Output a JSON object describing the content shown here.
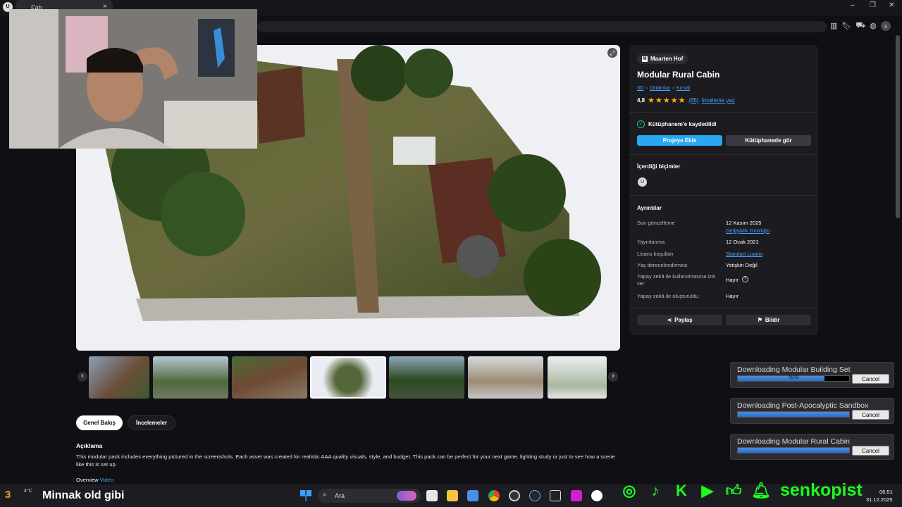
{
  "browser": {
    "tab_title": "Fab",
    "close_glyph": "×",
    "avatar_letter": "s"
  },
  "window": {
    "minimize": "–",
    "restore": "❐",
    "close": "✕"
  },
  "product": {
    "seller": "Maarten Hof",
    "title": "Modular Rural Cabin",
    "breadcrumb": [
      "3D",
      "Ortamlar",
      "Kırsal"
    ],
    "rating": "4,8",
    "stars": 5,
    "review_count": "(85)",
    "write_review": "İnceleme yaz",
    "saved_label": "Kütüphanem'e kaydedildi",
    "add_to_project": "Projeye Ekle",
    "view_in_library": "Kütüphanede gör",
    "formats_title": "İçerdiği biçimler",
    "details_title": "Ayrıntılar",
    "details": [
      {
        "label": "Son güncelleme",
        "value": "12 Kasım 2025",
        "link": "Değişiklik Günlüğü"
      },
      {
        "label": "Yayınlanma",
        "value": "12 Ocak 2021"
      },
      {
        "label": "Lisans koşulları",
        "value": "Standart Lisans",
        "is_link": true
      },
      {
        "label": "Yaş derecelendirmesi",
        "value": "Yetişkin Değil"
      },
      {
        "label": "Yapay zekâ ile kullanılmasına izin ver",
        "value": "Hayır",
        "help": true
      },
      {
        "label": "Yapay zekâ ile oluşturuldu",
        "value": "Hayır"
      }
    ],
    "share": "Paylaş",
    "report": "Bildir"
  },
  "thumbnails": {
    "count": 7,
    "selected_index": 3,
    "prev": "‹",
    "next": "›"
  },
  "tabs": [
    "Genel Bakış",
    "İncelemeler"
  ],
  "description": {
    "heading": "Açıklama",
    "text": "This modular pack includes everything pictured in the screenshots. Each asset was created for realistic AAA quality visuals, style, and budget. This pack can be perfect for your next game, lighting study or just to see how a scene like this is set up.",
    "overview_label": "Overview",
    "overview_link": "Video"
  },
  "downloads": [
    {
      "title": "Downloading Modular Building Set",
      "progress": 0.78,
      "progress_text": "%78",
      "cancel": "Cancel"
    },
    {
      "title": "Downloading Post-Apocalyptic Sandbox",
      "progress": 1.0,
      "progress_text": "",
      "cancel": "Cancel"
    },
    {
      "title": "Downloading Modular Rural Cabin",
      "progress": 1.0,
      "progress_text": "",
      "cancel": "Cancel"
    }
  ],
  "taskbar": {
    "weather_temp": "4°C",
    "overlay_number": "3",
    "now_playing": "Minnak old gibi",
    "search_placeholder": "Ara",
    "time": "06:51",
    "date": "31.12.2025"
  },
  "stream_overlay": {
    "handle": "senkopist"
  },
  "colors": {
    "accent": "#29a8f2",
    "link": "#4aa3ff",
    "star": "#f5b400",
    "social": "#1bff1b",
    "progress": "#2a6ec4"
  }
}
